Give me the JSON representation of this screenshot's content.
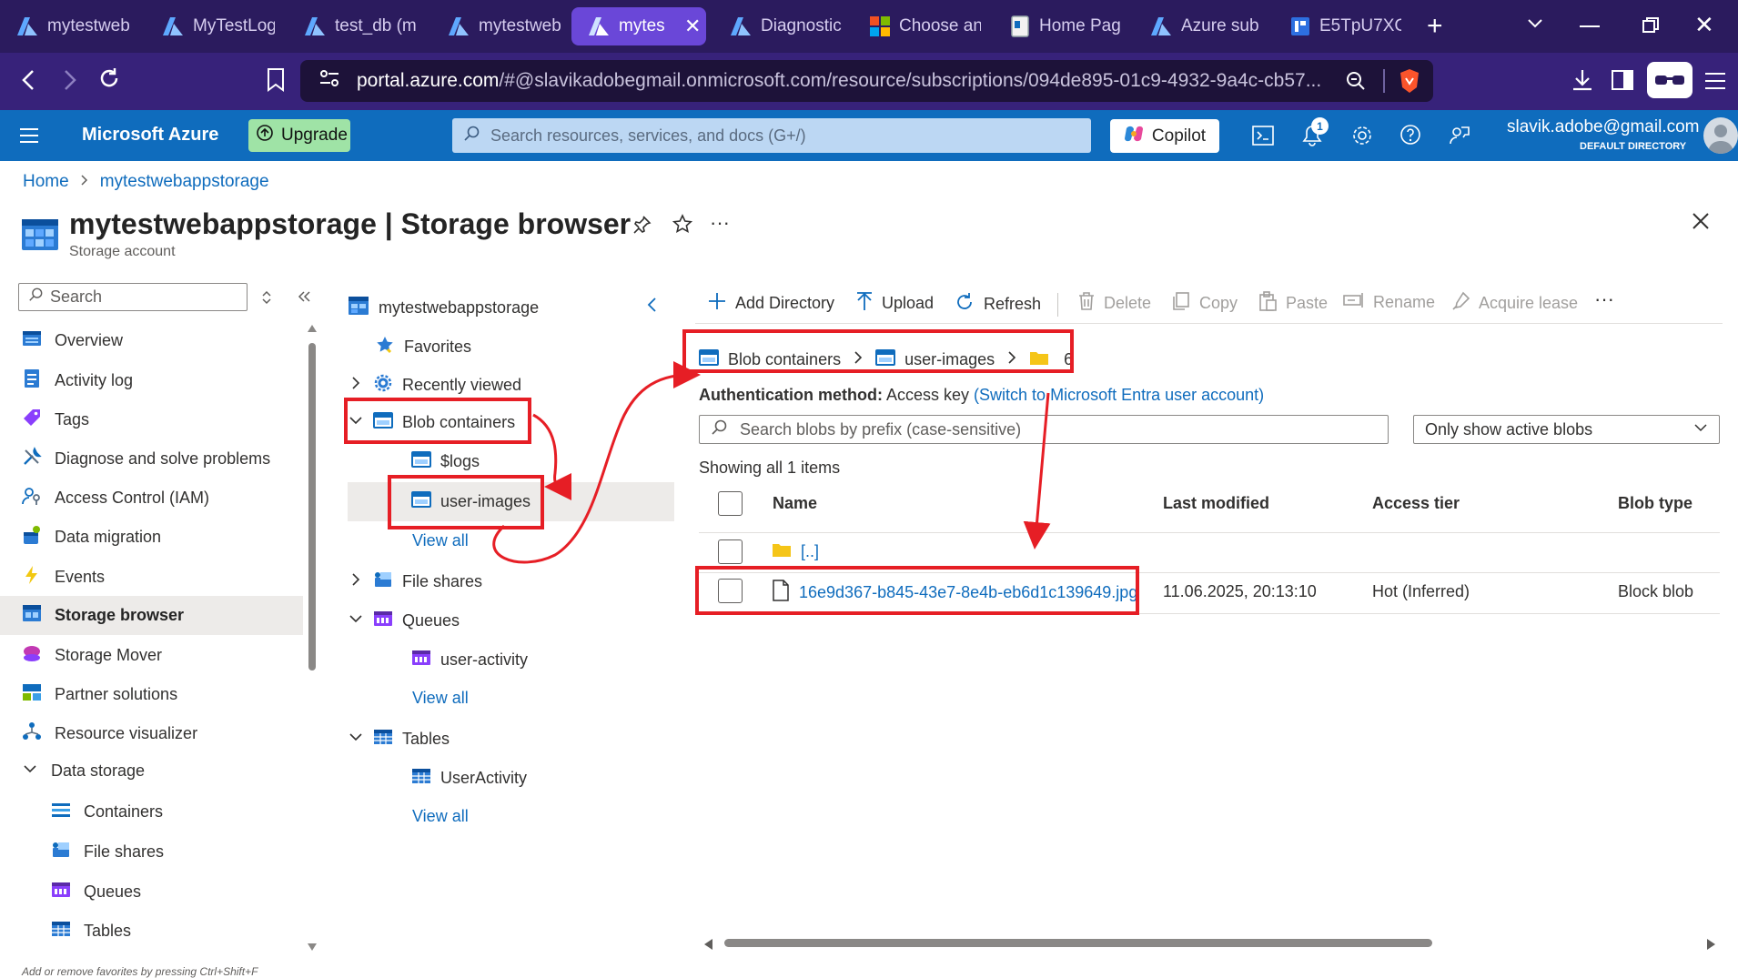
{
  "browser": {
    "tabs": [
      {
        "title": "mytestwebapp"
      },
      {
        "title": "MyTestLogic"
      },
      {
        "title": "test_db (m"
      },
      {
        "title": "mytestwebapp"
      },
      {
        "title": "mytes",
        "active": true
      },
      {
        "title": "Diagnostic"
      },
      {
        "title": "Choose an"
      },
      {
        "title": "Home Page"
      },
      {
        "title": "Azure sub"
      },
      {
        "title": "E5TpU7XC"
      }
    ],
    "url_host": "portal.azure.com",
    "url_rest": "/#@slavikadobegmail.onmicrosoft.com/resource/subscriptions/094de895-01c9-4932-9a4c-cb57..."
  },
  "azure_header": {
    "brand": "Microsoft Azure",
    "upgrade": "Upgrade",
    "search_placeholder": "Search resources, services, and docs (G+/)",
    "copilot": "Copilot",
    "notification_count": "1",
    "user_email": "slavik.adobe@gmail.com",
    "directory": "DEFAULT DIRECTORY"
  },
  "breadcrumb": {
    "home": "Home",
    "resource": "mytestwebappstorage"
  },
  "page": {
    "title": "mytestwebappstorage | Storage browser",
    "subtitle": "Storage account"
  },
  "left_nav": {
    "search_placeholder": "Search",
    "items": [
      {
        "label": "Overview"
      },
      {
        "label": "Activity log"
      },
      {
        "label": "Tags"
      },
      {
        "label": "Diagnose and solve problems"
      },
      {
        "label": "Access Control (IAM)"
      },
      {
        "label": "Data migration"
      },
      {
        "label": "Events"
      },
      {
        "label": "Storage browser"
      },
      {
        "label": "Storage Mover"
      },
      {
        "label": "Partner solutions"
      },
      {
        "label": "Resource visualizer"
      },
      {
        "label": "Data storage"
      },
      {
        "label": "Containers"
      },
      {
        "label": "File shares"
      },
      {
        "label": "Queues"
      },
      {
        "label": "Tables"
      }
    ],
    "footer_hint": "Add or remove favorites by pressing Ctrl+Shift+F"
  },
  "tree": {
    "root": "mytestwebappstorage",
    "favorites": "Favorites",
    "recently_viewed": "Recently viewed",
    "blob_containers": "Blob containers",
    "logs": "$logs",
    "user_images": "user-images",
    "view_all": "View all",
    "file_shares": "File shares",
    "queues": "Queues",
    "user_activity": "user-activity",
    "tables": "Tables",
    "user_activity_table": "UserActivity"
  },
  "toolbar": {
    "add_directory": "Add Directory",
    "upload": "Upload",
    "refresh": "Refresh",
    "delete": "Delete",
    "copy": "Copy",
    "paste": "Paste",
    "rename": "Rename",
    "acquire_lease": "Acquire lease",
    "more": "···"
  },
  "path": {
    "blob_containers": "Blob containers",
    "container": "user-images",
    "folder": "6"
  },
  "auth": {
    "label": "Authentication method:",
    "value": "Access key",
    "switch_link": "(Switch to Microsoft Entra user account)"
  },
  "filters": {
    "search_placeholder": "Search blobs by prefix (case-sensitive)",
    "dropdown_value": "Only show active blobs"
  },
  "listing": {
    "showing": "Showing all 1 items",
    "columns": [
      "Name",
      "Last modified",
      "Access tier",
      "Blob type"
    ],
    "parent_row": "[..]",
    "rows": [
      {
        "name": "16e9d367-b845-43e7-8e4b-eb6d1c139649.jpg",
        "last_modified": "11.06.2025, 20:13:10",
        "access_tier": "Hot (Inferred)",
        "blob_type": "Block blob"
      }
    ]
  },
  "colors": {
    "azure_blue": "#0f6cbd",
    "annotation_red": "#e61e25",
    "browser_purple": "#2b1b5e"
  }
}
